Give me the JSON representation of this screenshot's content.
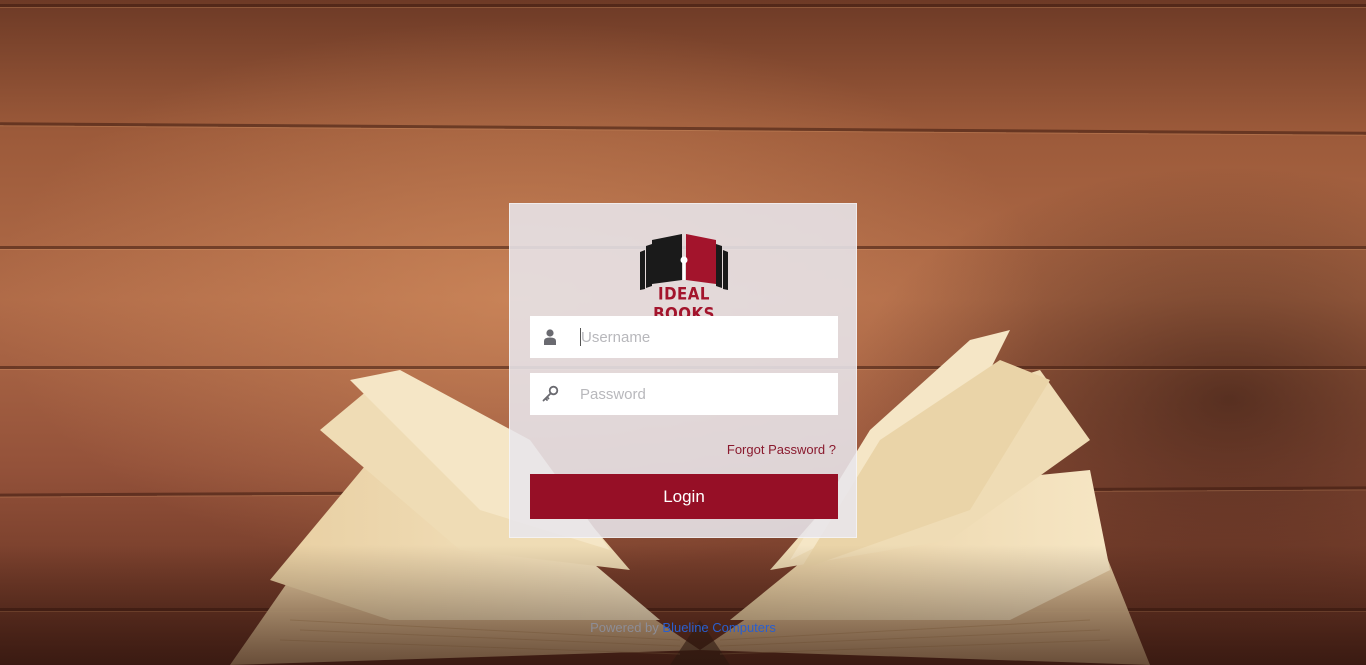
{
  "brand": {
    "name": "IDEAL BOOKS",
    "accent_color": "#960f26",
    "logo_icon": "open-book-logo"
  },
  "login_form": {
    "username": {
      "placeholder": "Username",
      "value": "",
      "icon": "user-icon"
    },
    "password": {
      "placeholder": "Password",
      "value": "",
      "icon": "key-icon"
    },
    "forgot_label": "Forgot Password ?",
    "submit_label": "Login"
  },
  "footer": {
    "prefix": "Powered by",
    "link_label": "Blueline Computers",
    "link_color": "#2a5fcf"
  }
}
